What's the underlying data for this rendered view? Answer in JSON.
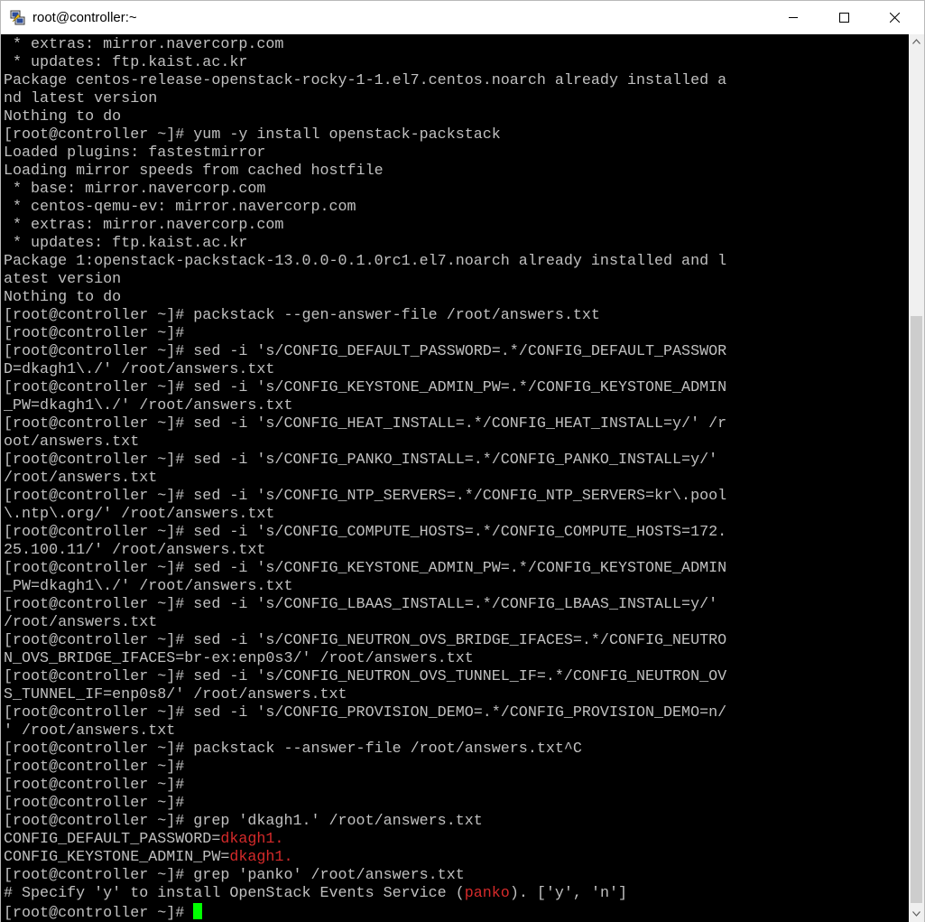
{
  "window": {
    "title": "root@controller:~",
    "icons": {
      "app": "putty-icon",
      "minimize": "minimize-icon",
      "maximize": "maximize-icon",
      "close": "close-icon"
    }
  },
  "terminal": {
    "colors": {
      "background": "#000000",
      "foreground": "#c0c0c0",
      "highlight": "#d52a2a",
      "cursor": "#00ff00"
    },
    "lines": [
      [
        {
          "t": " * extras: mirror.navercorp.com"
        }
      ],
      [
        {
          "t": " * updates: ftp.kaist.ac.kr"
        }
      ],
      [
        {
          "t": "Package centos-release-openstack-rocky-1-1.el7.centos.noarch already installed a"
        }
      ],
      [
        {
          "t": "nd latest version"
        }
      ],
      [
        {
          "t": "Nothing to do"
        }
      ],
      [
        {
          "t": "[root@controller ~]# yum -y install openstack-packstack"
        }
      ],
      [
        {
          "t": "Loaded plugins: fastestmirror"
        }
      ],
      [
        {
          "t": "Loading mirror speeds from cached hostfile"
        }
      ],
      [
        {
          "t": " * base: mirror.navercorp.com"
        }
      ],
      [
        {
          "t": " * centos-qemu-ev: mirror.navercorp.com"
        }
      ],
      [
        {
          "t": " * extras: mirror.navercorp.com"
        }
      ],
      [
        {
          "t": " * updates: ftp.kaist.ac.kr"
        }
      ],
      [
        {
          "t": "Package 1:openstack-packstack-13.0.0-0.1.0rc1.el7.noarch already installed and l"
        }
      ],
      [
        {
          "t": "atest version"
        }
      ],
      [
        {
          "t": "Nothing to do"
        }
      ],
      [
        {
          "t": "[root@controller ~]# packstack --gen-answer-file /root/answers.txt"
        }
      ],
      [
        {
          "t": "[root@controller ~]#"
        }
      ],
      [
        {
          "t": "[root@controller ~]# sed -i 's/CONFIG_DEFAULT_PASSWORD=.*/CONFIG_DEFAULT_PASSWOR"
        }
      ],
      [
        {
          "t": "D=dkagh1\\./' /root/answers.txt"
        }
      ],
      [
        {
          "t": "[root@controller ~]# sed -i 's/CONFIG_KEYSTONE_ADMIN_PW=.*/CONFIG_KEYSTONE_ADMIN"
        }
      ],
      [
        {
          "t": "_PW=dkagh1\\./' /root/answers.txt"
        }
      ],
      [
        {
          "t": "[root@controller ~]# sed -i 's/CONFIG_HEAT_INSTALL=.*/CONFIG_HEAT_INSTALL=y/' /r"
        }
      ],
      [
        {
          "t": "oot/answers.txt"
        }
      ],
      [
        {
          "t": "[root@controller ~]# sed -i 's/CONFIG_PANKO_INSTALL=.*/CONFIG_PANKO_INSTALL=y/'"
        }
      ],
      [
        {
          "t": "/root/answers.txt"
        }
      ],
      [
        {
          "t": "[root@controller ~]# sed -i 's/CONFIG_NTP_SERVERS=.*/CONFIG_NTP_SERVERS=kr\\.pool"
        }
      ],
      [
        {
          "t": "\\.ntp\\.org/' /root/answers.txt"
        }
      ],
      [
        {
          "t": "[root@controller ~]# sed -i 's/CONFIG_COMPUTE_HOSTS=.*/CONFIG_COMPUTE_HOSTS=172."
        }
      ],
      [
        {
          "t": "25.100.11/' /root/answers.txt"
        }
      ],
      [
        {
          "t": "[root@controller ~]# sed -i 's/CONFIG_KEYSTONE_ADMIN_PW=.*/CONFIG_KEYSTONE_ADMIN"
        }
      ],
      [
        {
          "t": "_PW=dkagh1\\./' /root/answers.txt"
        }
      ],
      [
        {
          "t": "[root@controller ~]# sed -i 's/CONFIG_LBAAS_INSTALL=.*/CONFIG_LBAAS_INSTALL=y/'"
        }
      ],
      [
        {
          "t": "/root/answers.txt"
        }
      ],
      [
        {
          "t": "[root@controller ~]# sed -i 's/CONFIG_NEUTRON_OVS_BRIDGE_IFACES=.*/CONFIG_NEUTRO"
        }
      ],
      [
        {
          "t": "N_OVS_BRIDGE_IFACES=br-ex:enp0s3/' /root/answers.txt"
        }
      ],
      [
        {
          "t": "[root@controller ~]# sed -i 's/CONFIG_NEUTRON_OVS_TUNNEL_IF=.*/CONFIG_NEUTRON_OV"
        }
      ],
      [
        {
          "t": "S_TUNNEL_IF=enp0s8/' /root/answers.txt"
        }
      ],
      [
        {
          "t": "[root@controller ~]# sed -i 's/CONFIG_PROVISION_DEMO=.*/CONFIG_PROVISION_DEMO=n/"
        }
      ],
      [
        {
          "t": "' /root/answers.txt"
        }
      ],
      [
        {
          "t": "[root@controller ~]# packstack --answer-file /root/answers.txt^C"
        }
      ],
      [
        {
          "t": "[root@controller ~]#"
        }
      ],
      [
        {
          "t": "[root@controller ~]#"
        }
      ],
      [
        {
          "t": "[root@controller ~]#"
        }
      ],
      [
        {
          "t": "[root@controller ~]# grep 'dkagh1.' /root/answers.txt"
        }
      ],
      [
        {
          "t": "CONFIG_DEFAULT_PASSWORD="
        },
        {
          "t": "dkagh1.",
          "hl": true
        }
      ],
      [
        {
          "t": "CONFIG_KEYSTONE_ADMIN_PW="
        },
        {
          "t": "dkagh1.",
          "hl": true
        }
      ],
      [
        {
          "t": "[root@controller ~]# grep 'panko' /root/answers.txt"
        }
      ],
      [
        {
          "t": "# Specify 'y' to install OpenStack Events Service ("
        },
        {
          "t": "panko",
          "hl": true
        },
        {
          "t": "). ['y', 'n']"
        }
      ],
      [
        {
          "t": "[root@controller ~]# "
        },
        {
          "cursor": true
        }
      ]
    ]
  },
  "scrollbar": {
    "icons": {
      "up": "scroll-up-arrow-icon",
      "down": "scroll-down-arrow-icon"
    }
  }
}
